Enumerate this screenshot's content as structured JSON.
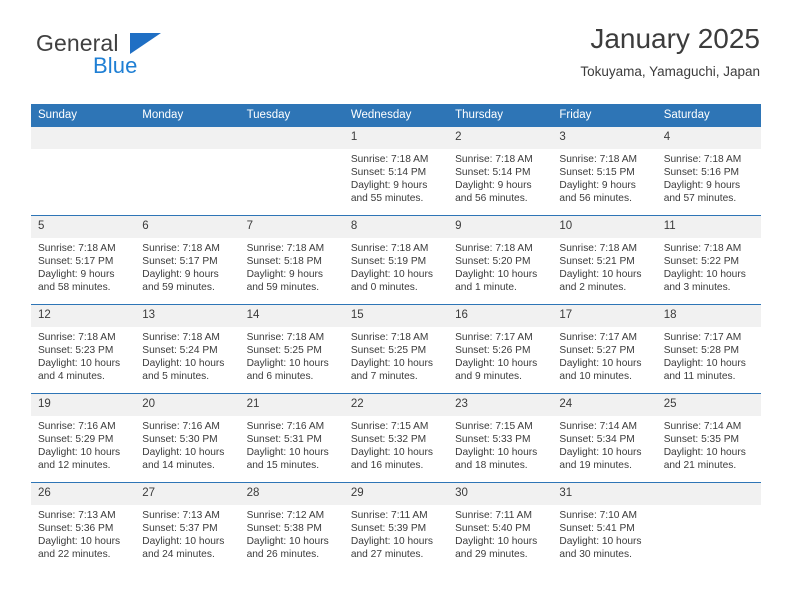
{
  "brand": {
    "name_top": "General",
    "name_bottom": "Blue",
    "triangle_color": "#1f6fc4",
    "blue_color": "#1f7fd4"
  },
  "header": {
    "title": "January 2025",
    "subtitle": "Tokuyama, Yamaguchi, Japan",
    "accent_color": "#2e75b6"
  },
  "calendar": {
    "weekday_headers": [
      "Sunday",
      "Monday",
      "Tuesday",
      "Wednesday",
      "Thursday",
      "Friday",
      "Saturday"
    ],
    "weeks": [
      [
        {
          "day": "",
          "blank": true
        },
        {
          "day": "",
          "blank": true
        },
        {
          "day": "",
          "blank": true
        },
        {
          "day": "1",
          "sunrise": "Sunrise: 7:18 AM",
          "sunset": "Sunset: 5:14 PM",
          "daylight": "Daylight: 9 hours and 55 minutes."
        },
        {
          "day": "2",
          "sunrise": "Sunrise: 7:18 AM",
          "sunset": "Sunset: 5:14 PM",
          "daylight": "Daylight: 9 hours and 56 minutes."
        },
        {
          "day": "3",
          "sunrise": "Sunrise: 7:18 AM",
          "sunset": "Sunset: 5:15 PM",
          "daylight": "Daylight: 9 hours and 56 minutes."
        },
        {
          "day": "4",
          "sunrise": "Sunrise: 7:18 AM",
          "sunset": "Sunset: 5:16 PM",
          "daylight": "Daylight: 9 hours and 57 minutes."
        }
      ],
      [
        {
          "day": "5",
          "sunrise": "Sunrise: 7:18 AM",
          "sunset": "Sunset: 5:17 PM",
          "daylight": "Daylight: 9 hours and 58 minutes."
        },
        {
          "day": "6",
          "sunrise": "Sunrise: 7:18 AM",
          "sunset": "Sunset: 5:17 PM",
          "daylight": "Daylight: 9 hours and 59 minutes."
        },
        {
          "day": "7",
          "sunrise": "Sunrise: 7:18 AM",
          "sunset": "Sunset: 5:18 PM",
          "daylight": "Daylight: 9 hours and 59 minutes."
        },
        {
          "day": "8",
          "sunrise": "Sunrise: 7:18 AM",
          "sunset": "Sunset: 5:19 PM",
          "daylight": "Daylight: 10 hours and 0 minutes."
        },
        {
          "day": "9",
          "sunrise": "Sunrise: 7:18 AM",
          "sunset": "Sunset: 5:20 PM",
          "daylight": "Daylight: 10 hours and 1 minute."
        },
        {
          "day": "10",
          "sunrise": "Sunrise: 7:18 AM",
          "sunset": "Sunset: 5:21 PM",
          "daylight": "Daylight: 10 hours and 2 minutes."
        },
        {
          "day": "11",
          "sunrise": "Sunrise: 7:18 AM",
          "sunset": "Sunset: 5:22 PM",
          "daylight": "Daylight: 10 hours and 3 minutes."
        }
      ],
      [
        {
          "day": "12",
          "sunrise": "Sunrise: 7:18 AM",
          "sunset": "Sunset: 5:23 PM",
          "daylight": "Daylight: 10 hours and 4 minutes."
        },
        {
          "day": "13",
          "sunrise": "Sunrise: 7:18 AM",
          "sunset": "Sunset: 5:24 PM",
          "daylight": "Daylight: 10 hours and 5 minutes."
        },
        {
          "day": "14",
          "sunrise": "Sunrise: 7:18 AM",
          "sunset": "Sunset: 5:25 PM",
          "daylight": "Daylight: 10 hours and 6 minutes."
        },
        {
          "day": "15",
          "sunrise": "Sunrise: 7:18 AM",
          "sunset": "Sunset: 5:25 PM",
          "daylight": "Daylight: 10 hours and 7 minutes."
        },
        {
          "day": "16",
          "sunrise": "Sunrise: 7:17 AM",
          "sunset": "Sunset: 5:26 PM",
          "daylight": "Daylight: 10 hours and 9 minutes."
        },
        {
          "day": "17",
          "sunrise": "Sunrise: 7:17 AM",
          "sunset": "Sunset: 5:27 PM",
          "daylight": "Daylight: 10 hours and 10 minutes."
        },
        {
          "day": "18",
          "sunrise": "Sunrise: 7:17 AM",
          "sunset": "Sunset: 5:28 PM",
          "daylight": "Daylight: 10 hours and 11 minutes."
        }
      ],
      [
        {
          "day": "19",
          "sunrise": "Sunrise: 7:16 AM",
          "sunset": "Sunset: 5:29 PM",
          "daylight": "Daylight: 10 hours and 12 minutes."
        },
        {
          "day": "20",
          "sunrise": "Sunrise: 7:16 AM",
          "sunset": "Sunset: 5:30 PM",
          "daylight": "Daylight: 10 hours and 14 minutes."
        },
        {
          "day": "21",
          "sunrise": "Sunrise: 7:16 AM",
          "sunset": "Sunset: 5:31 PM",
          "daylight": "Daylight: 10 hours and 15 minutes."
        },
        {
          "day": "22",
          "sunrise": "Sunrise: 7:15 AM",
          "sunset": "Sunset: 5:32 PM",
          "daylight": "Daylight: 10 hours and 16 minutes."
        },
        {
          "day": "23",
          "sunrise": "Sunrise: 7:15 AM",
          "sunset": "Sunset: 5:33 PM",
          "daylight": "Daylight: 10 hours and 18 minutes."
        },
        {
          "day": "24",
          "sunrise": "Sunrise: 7:14 AM",
          "sunset": "Sunset: 5:34 PM",
          "daylight": "Daylight: 10 hours and 19 minutes."
        },
        {
          "day": "25",
          "sunrise": "Sunrise: 7:14 AM",
          "sunset": "Sunset: 5:35 PM",
          "daylight": "Daylight: 10 hours and 21 minutes."
        }
      ],
      [
        {
          "day": "26",
          "sunrise": "Sunrise: 7:13 AM",
          "sunset": "Sunset: 5:36 PM",
          "daylight": "Daylight: 10 hours and 22 minutes."
        },
        {
          "day": "27",
          "sunrise": "Sunrise: 7:13 AM",
          "sunset": "Sunset: 5:37 PM",
          "daylight": "Daylight: 10 hours and 24 minutes."
        },
        {
          "day": "28",
          "sunrise": "Sunrise: 7:12 AM",
          "sunset": "Sunset: 5:38 PM",
          "daylight": "Daylight: 10 hours and 26 minutes."
        },
        {
          "day": "29",
          "sunrise": "Sunrise: 7:11 AM",
          "sunset": "Sunset: 5:39 PM",
          "daylight": "Daylight: 10 hours and 27 minutes."
        },
        {
          "day": "30",
          "sunrise": "Sunrise: 7:11 AM",
          "sunset": "Sunset: 5:40 PM",
          "daylight": "Daylight: 10 hours and 29 minutes."
        },
        {
          "day": "31",
          "sunrise": "Sunrise: 7:10 AM",
          "sunset": "Sunset: 5:41 PM",
          "daylight": "Daylight: 10 hours and 30 minutes."
        },
        {
          "day": "",
          "blank": true
        }
      ]
    ]
  }
}
